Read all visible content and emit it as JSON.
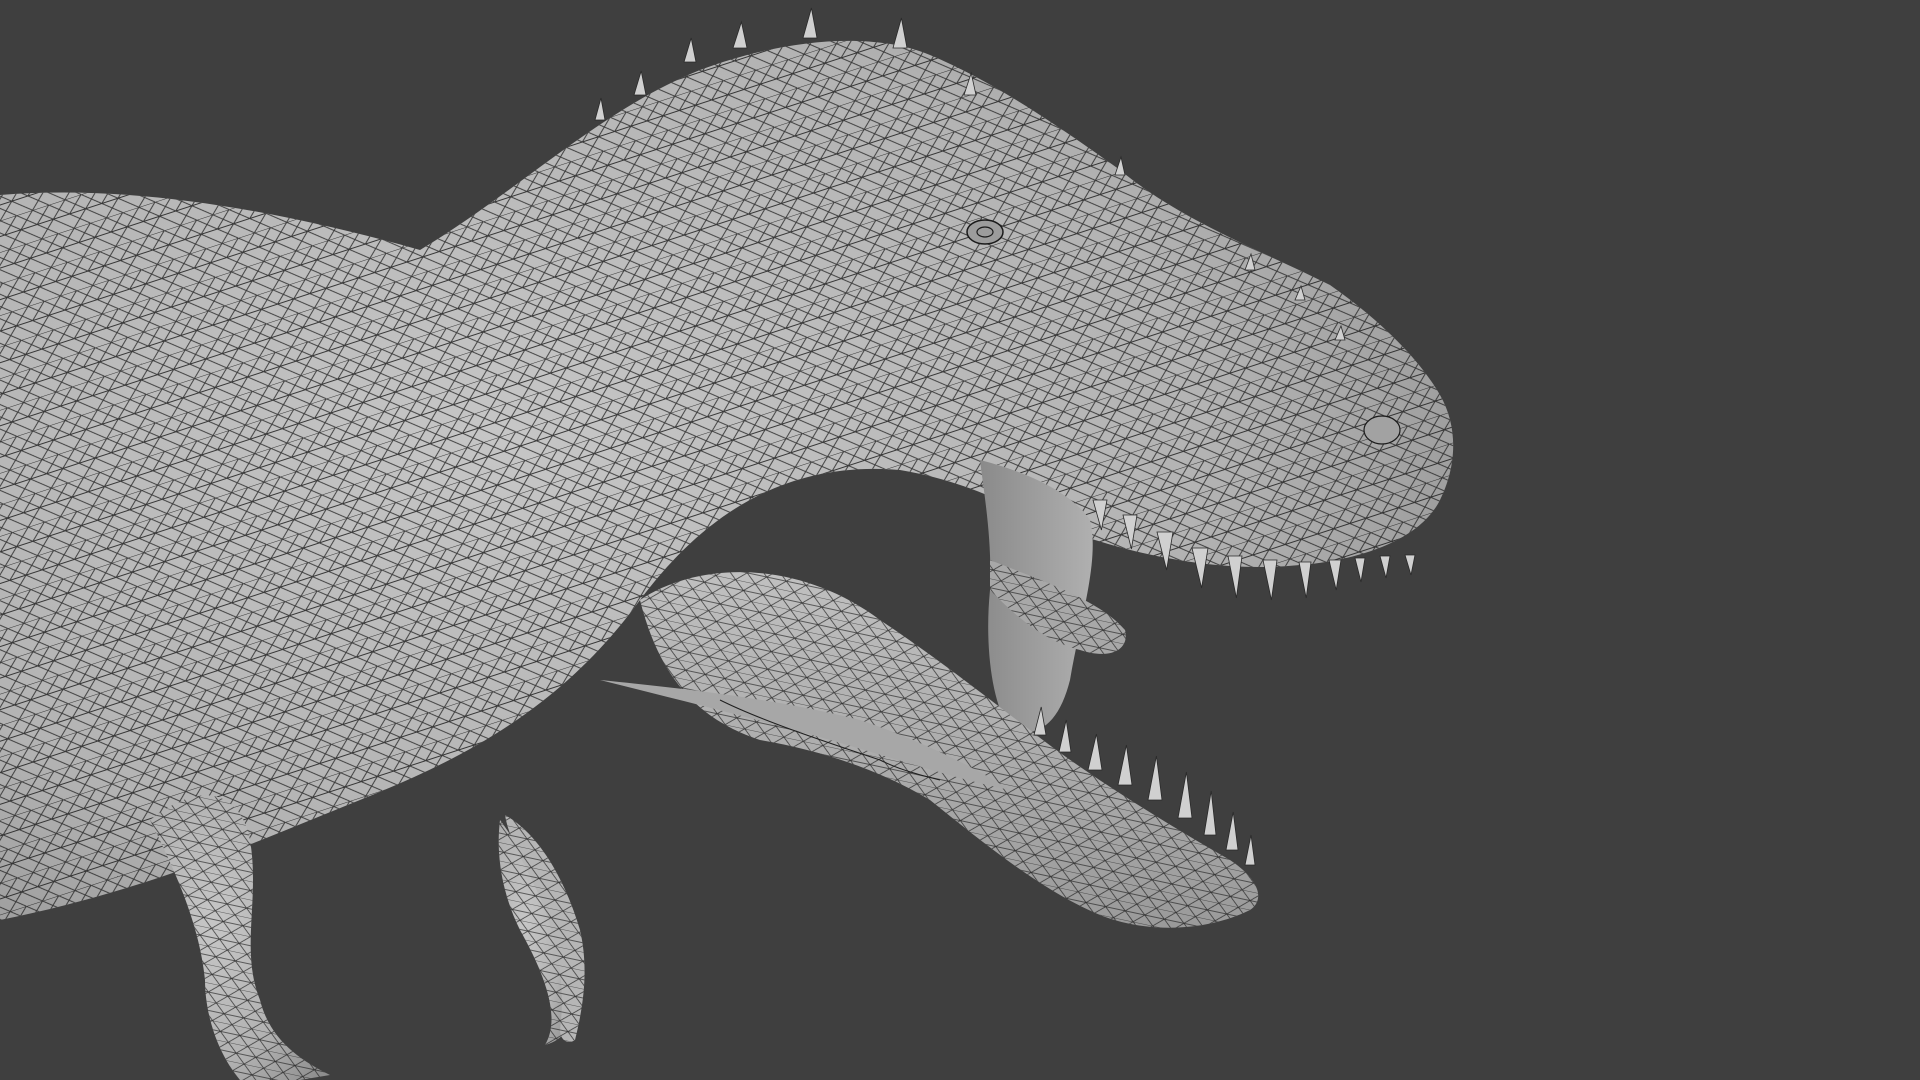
{
  "viewport": {
    "background_color": "#3f3f3f",
    "shading": "solid-with-wireframe",
    "subject": "dinosaur-mesh",
    "mesh_fill_color": "#b9b9b9",
    "mesh_shadow_color": "#8e8e8e",
    "wire_color": "#202020"
  }
}
